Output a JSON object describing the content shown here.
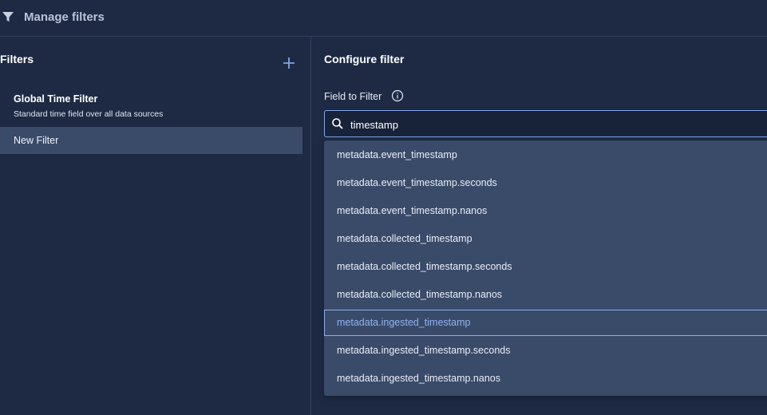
{
  "header": {
    "title": "Manage filters",
    "icon": "funnel-icon"
  },
  "left_panel": {
    "heading": "Filters",
    "add_icon": "plus-icon",
    "items": [
      {
        "title": "Global Time Filter",
        "subtitle": "Standard time field over all data sources",
        "selected": false
      },
      {
        "title": "New Filter",
        "selected": true
      }
    ]
  },
  "right_panel": {
    "heading": "Configure filter",
    "field_label": "Field to Filter",
    "info_icon": "info-icon",
    "search": {
      "value": "timestamp",
      "icon": "search-icon"
    },
    "options": [
      "metadata.event_timestamp",
      "metadata.event_timestamp.seconds",
      "metadata.event_timestamp.nanos",
      "metadata.collected_timestamp",
      "metadata.collected_timestamp.seconds",
      "metadata.collected_timestamp.nanos",
      "metadata.ingested_timestamp",
      "metadata.ingested_timestamp.seconds",
      "metadata.ingested_timestamp.nanos"
    ],
    "highlighted_option": "metadata.ingested_timestamp"
  },
  "colors": {
    "background": "#1e2a44",
    "selected_item": "#3a4a69",
    "accent": "#7fa6e8",
    "highlight_text": "#8fb4f3"
  }
}
